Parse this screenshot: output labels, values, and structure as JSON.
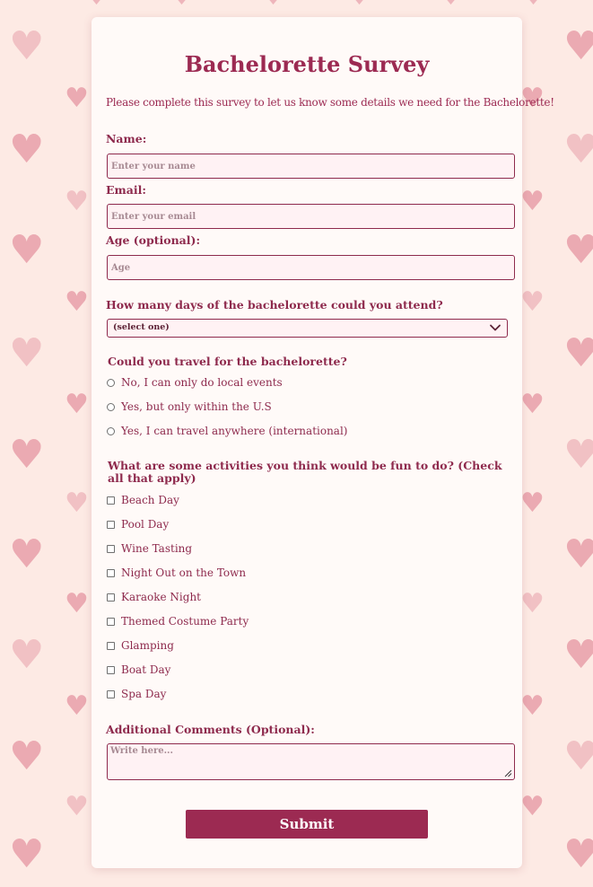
{
  "form": {
    "title": "Bachelorette Survey",
    "intro": "Please complete this survey to let us know some details we need for the Bachelorette!",
    "name_label": "Name:",
    "name_placeholder": "Enter your name",
    "email_label": "Email:",
    "email_placeholder": "Enter your email",
    "age_label": "Age (optional):",
    "age_placeholder": "Age",
    "days_label": "How many days of the bachelorette could you attend?",
    "days_selected": "(select one)",
    "travel_label": "Could you travel for the bachelorette?",
    "travel_options": [
      "No, I can only do local events",
      "Yes, but only within the U.S",
      "Yes, I can travel anywhere (international)"
    ],
    "activities_label": "What are some activities you think would be fun to do? (Check all that apply)",
    "activities": [
      "Beach Day",
      "Pool Day",
      "Wine Tasting",
      "Night Out on the Town",
      "Karaoke Night",
      "Themed Costume Party",
      "Glamping",
      "Boat Day",
      "Spa Day"
    ],
    "comments_label": "Additional Comments (Optional):",
    "comments_placeholder": "Write here...",
    "submit_label": "Submit"
  },
  "colors": {
    "background": "#fdeae4",
    "card": "#fffaf8",
    "accent": "#9c2a52",
    "input_fill": "#fff2f4",
    "heart": "#e8a0aa"
  },
  "icons": {
    "background_pattern": "heart-icon",
    "select_arrow": "chevron-down-icon",
    "resize_handle": "resize-grip-icon"
  }
}
